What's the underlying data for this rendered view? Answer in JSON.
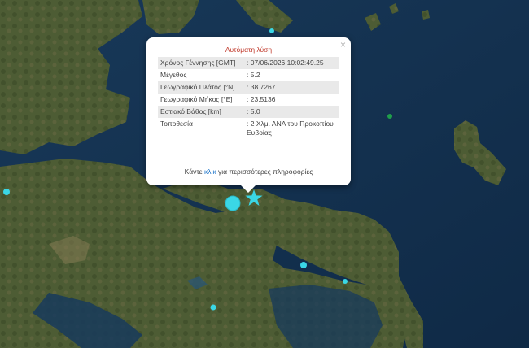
{
  "popup": {
    "title": "Αυτόματη λύση",
    "close": "×",
    "rows": [
      {
        "key": "Χρόνος Γέννησης [GMT]",
        "value": "07/06/2026 10:02:49.25"
      },
      {
        "key": "Μέγεθος",
        "value": "5.2"
      },
      {
        "key": "Γεωγραφικό Πλάτος [°N]",
        "value": "38.7267"
      },
      {
        "key": "Γεωγραφικό Μήκος [°E]",
        "value": "23.5136"
      },
      {
        "key": "Εστιακό Βάθος [km]",
        "value": "5.0"
      },
      {
        "key": "Τοποθεσία",
        "value": "2 Χλμ. ΑΝΑ του Προκοπίου Ευβοίας"
      }
    ],
    "footer_before": "Κάντε",
    "footer_link": "κλικ",
    "footer_after": "για περισσότερες πληροφορίες"
  },
  "colors": {
    "sea": "#14324f",
    "land": "#4a5a33",
    "marker": "#3ad7e6",
    "minor_quake": "#1f9e4a"
  },
  "markers": [
    {
      "name": "epicenter-star-icon"
    },
    {
      "name": "quake-circle-large"
    },
    {
      "name": "quake-circle-small"
    }
  ]
}
